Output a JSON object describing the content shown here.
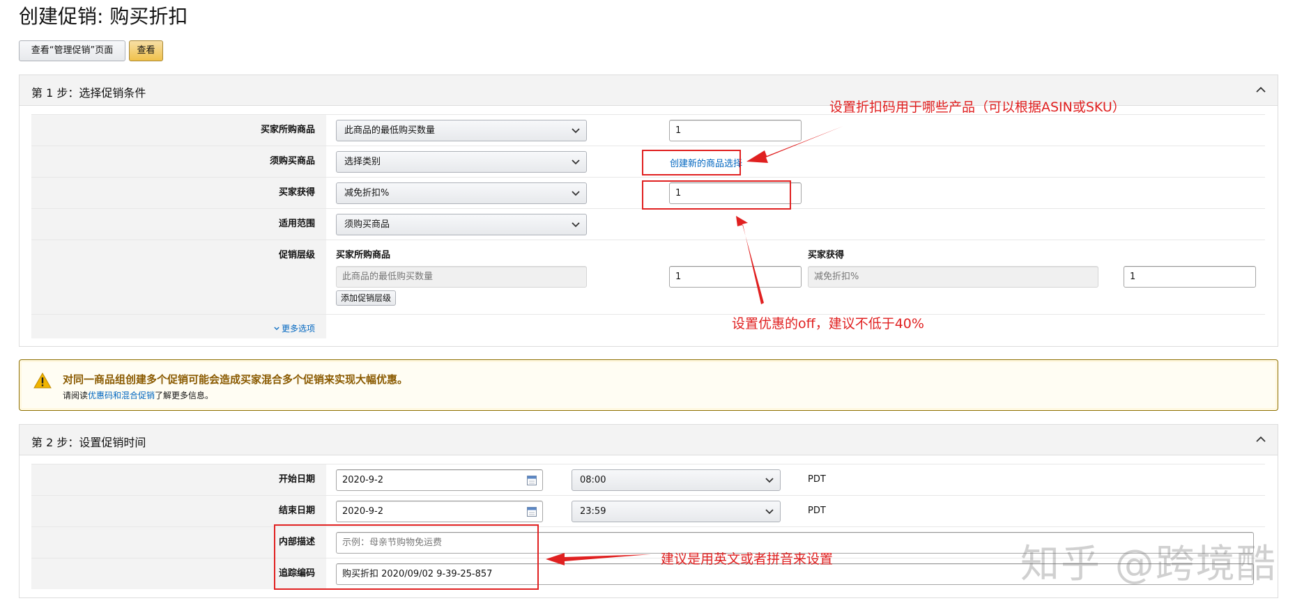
{
  "page": {
    "title": "创建促销: 购买折扣"
  },
  "toolbar": {
    "view_manage_label": "查看“管理促销”页面",
    "view_label": "查看"
  },
  "step1": {
    "title": "第 1 步：选择促销条件",
    "rows": {
      "buyer_purchases": {
        "label": "买家所购商品",
        "select": "此商品的最低购买数量",
        "value": "1"
      },
      "purchased_items": {
        "label": "须购买商品",
        "select": "选择类别",
        "link": "创建新的商品选择"
      },
      "buyer_gets": {
        "label": "买家获得",
        "select": "减免折扣%",
        "value": "1"
      },
      "applies_to": {
        "label": "适用范围",
        "select": "须购买商品"
      },
      "tiers": {
        "label": "促销层级",
        "col1_header": "买家所购商品",
        "col2_header": "买家获得",
        "tier_condition": "此商品的最低购买数量",
        "tier_qty": "1",
        "tier_benefit": "减免折扣%",
        "tier_value": "1",
        "add_tier_label": "添加促销层级"
      },
      "more_options": "更多选项"
    }
  },
  "warning": {
    "title": "对同一商品组创建多个促销可能会造成买家混合多个促销来实现大幅优惠。",
    "pre": "请阅读",
    "link": "优惠码和混合促销",
    "post": "了解更多信息。"
  },
  "step2": {
    "title": "第 2 步：设置促销时间",
    "rows": {
      "start": {
        "label": "开始日期",
        "date": "2020-9-2",
        "time": "08:00",
        "tz": "PDT"
      },
      "end": {
        "label": "结束日期",
        "date": "2020-9-2",
        "time": "23:59",
        "tz": "PDT"
      },
      "internal_desc": {
        "label": "内部描述",
        "placeholder": "示例：母亲节购物免运费"
      },
      "tracking_code": {
        "label": "追踪编码",
        "value": "购买折扣 2020/09/02 9-39-25-857"
      }
    }
  },
  "annotations": {
    "products_note": "设置折扣码用于哪些产品（可以根据ASIN或SKU）",
    "off_note": "设置优惠的off，建议不低于40%",
    "english_note": "建议是用英文或者拼音来设置"
  },
  "watermark": "知乎 @跨境酷",
  "colors": {
    "annotation": "#e02020",
    "link": "#0066c0",
    "warning_border": "#8c6e00",
    "primary_button": "#f0c14b"
  }
}
